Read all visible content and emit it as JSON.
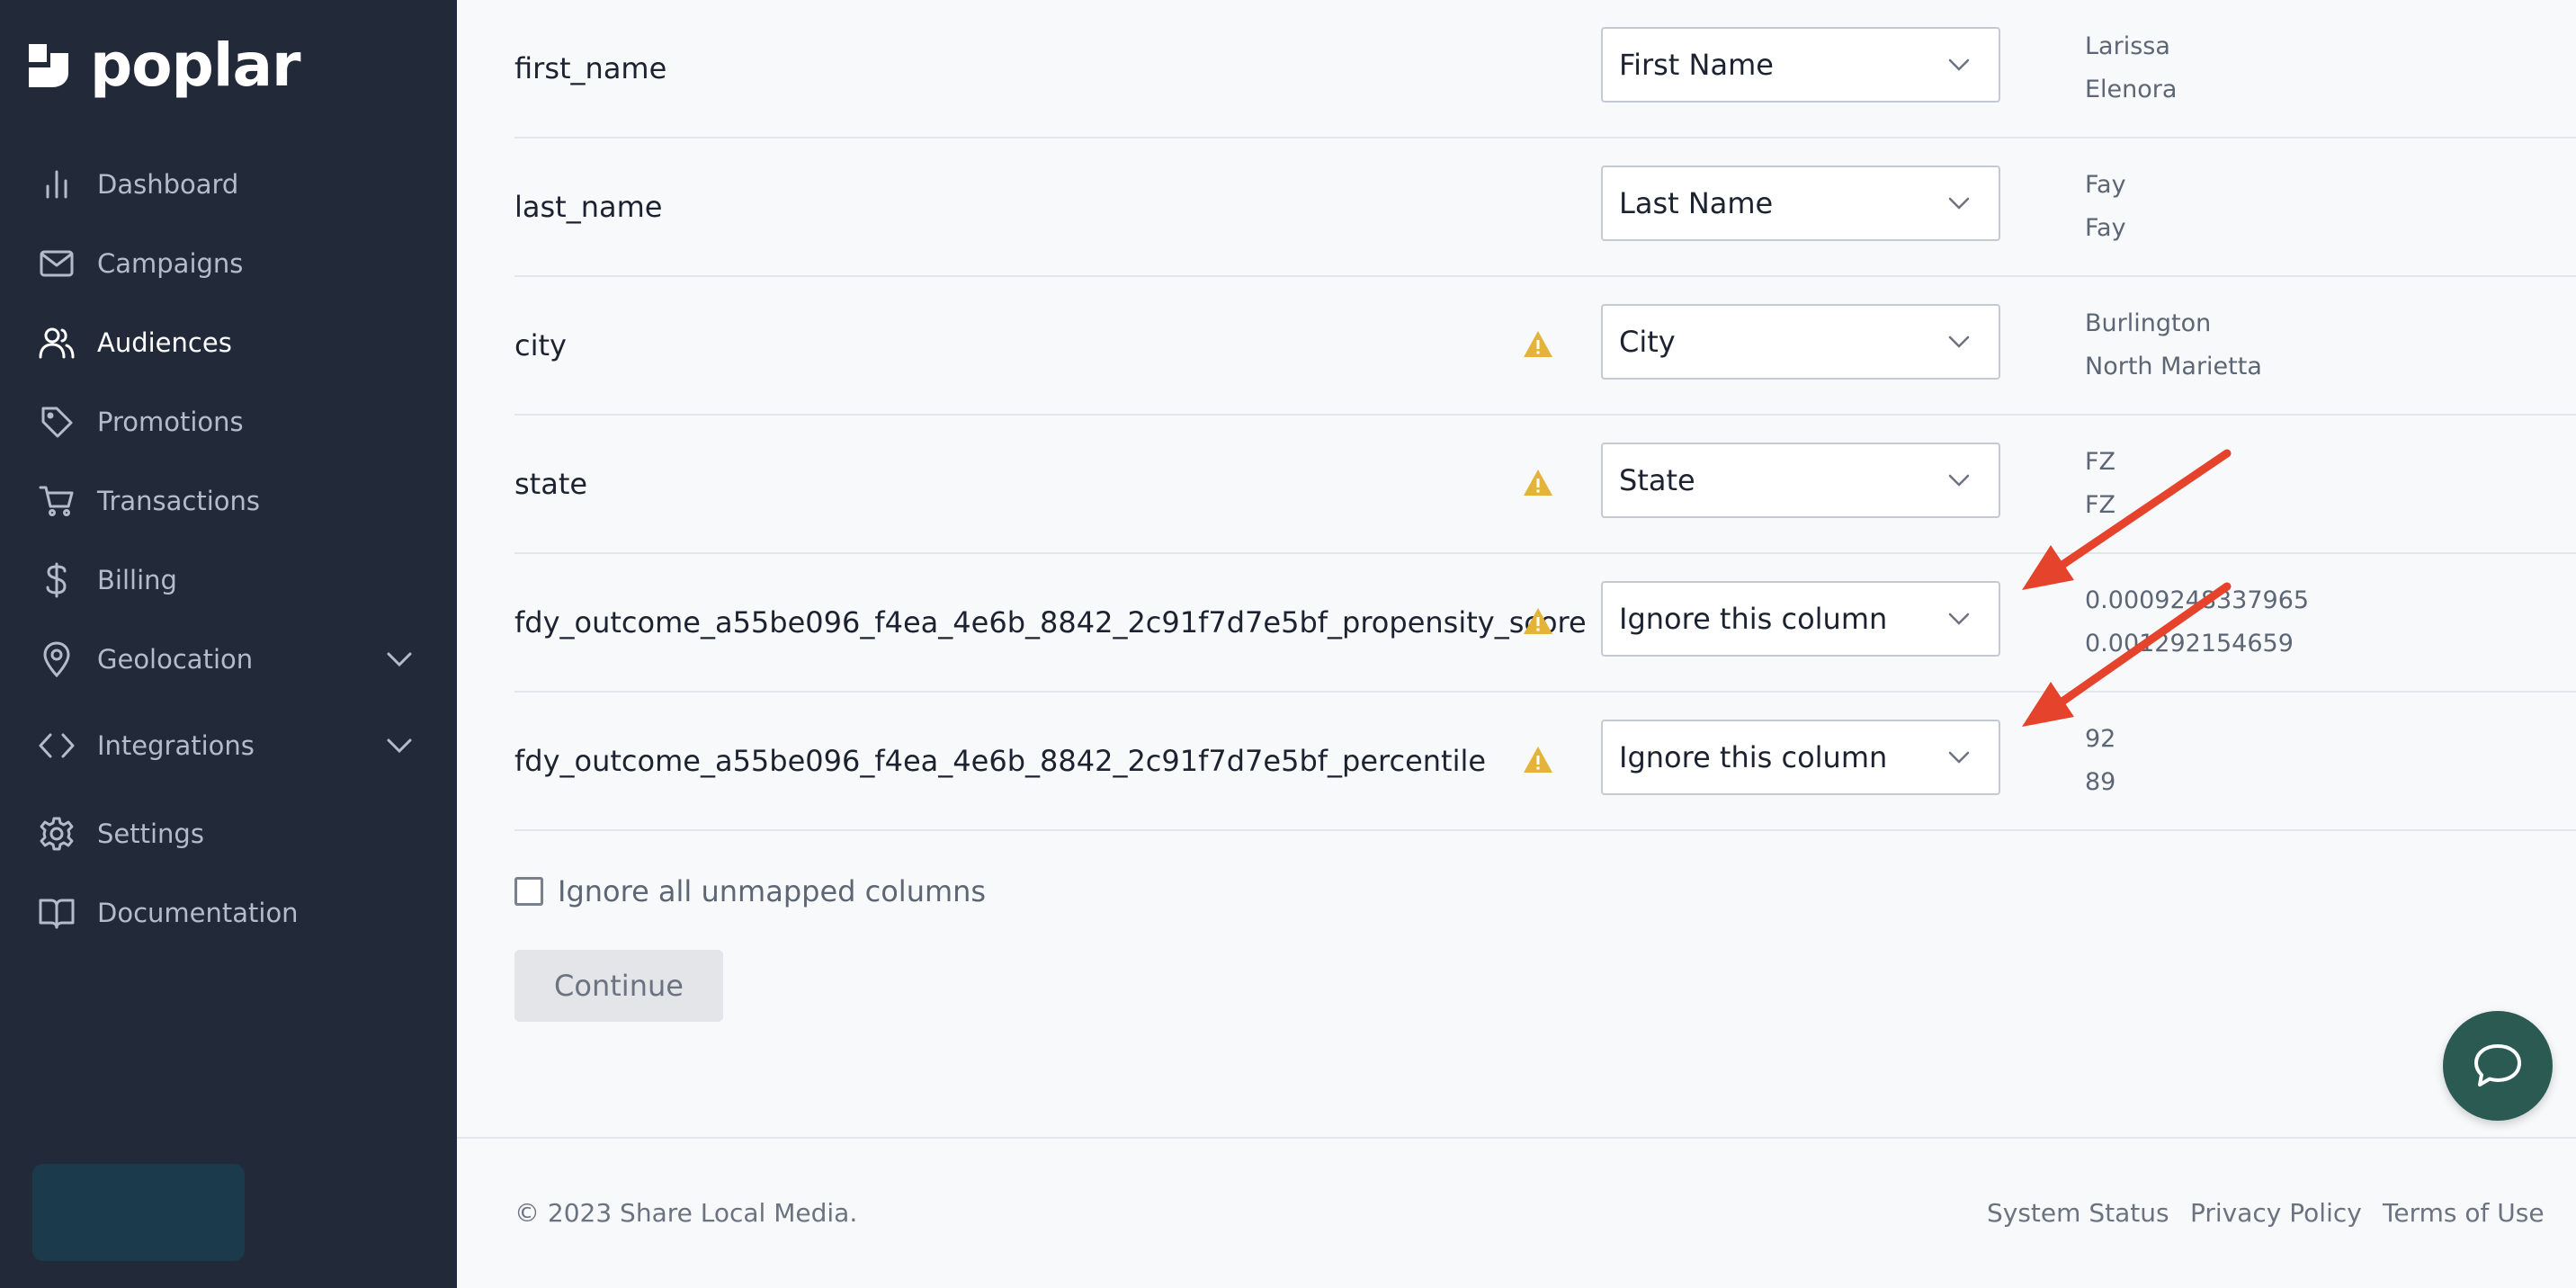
{
  "brand": {
    "name": "poplar"
  },
  "sidebar": {
    "items": [
      {
        "label": "Dashboard",
        "icon": "bar-chart-icon",
        "active": false
      },
      {
        "label": "Campaigns",
        "icon": "mail-icon",
        "active": false
      },
      {
        "label": "Audiences",
        "icon": "users-icon",
        "active": true
      },
      {
        "label": "Promotions",
        "icon": "tag-icon",
        "active": false
      },
      {
        "label": "Transactions",
        "icon": "cart-icon",
        "active": false
      },
      {
        "label": "Billing",
        "icon": "dollar-icon",
        "active": false
      },
      {
        "label": "Geolocation",
        "icon": "location-pin-icon",
        "active": false,
        "expandable": true
      },
      {
        "label": "Integrations",
        "icon": "code-icon",
        "active": false,
        "expandable": true
      },
      {
        "label": "Settings",
        "icon": "gear-icon",
        "active": false
      },
      {
        "label": "Documentation",
        "icon": "book-icon",
        "active": false
      }
    ]
  },
  "mapping": {
    "rows": [
      {
        "column": "first_name",
        "warning": false,
        "selected": "First Name",
        "samples": [
          "Larissa",
          "Elenora"
        ]
      },
      {
        "column": "last_name",
        "warning": false,
        "selected": "Last Name",
        "samples": [
          "Fay",
          "Fay"
        ]
      },
      {
        "column": "city",
        "warning": true,
        "selected": "City",
        "samples": [
          "Burlington",
          "North Marietta"
        ]
      },
      {
        "column": "state",
        "warning": true,
        "selected": "State",
        "samples": [
          "FZ",
          "FZ"
        ]
      },
      {
        "column": "fdy_outcome_a55be096_f4ea_4e6b_8842_2c91f7d7e5bf_propensity_score",
        "warning": true,
        "selected": "Ignore this column",
        "samples": [
          "0.0009248337965",
          "0.001292154659"
        ]
      },
      {
        "column": "fdy_outcome_a55be096_f4ea_4e6b_8842_2c91f7d7e5bf_percentile",
        "warning": true,
        "selected": "Ignore this column",
        "samples": [
          "92",
          "89"
        ]
      }
    ],
    "ignore_unmapped_label": "Ignore all unmapped columns",
    "ignore_unmapped_checked": false,
    "continue_label": "Continue"
  },
  "footer": {
    "copyright": "© 2023 Share Local Media.",
    "links": [
      "System Status",
      "Privacy Policy",
      "Terms of Use"
    ]
  },
  "colors": {
    "sidebar_bg": "#222a3a",
    "warning": "#e4b33a",
    "annotation_arrow": "#e5432c",
    "chat_button": "#2b5a52"
  }
}
